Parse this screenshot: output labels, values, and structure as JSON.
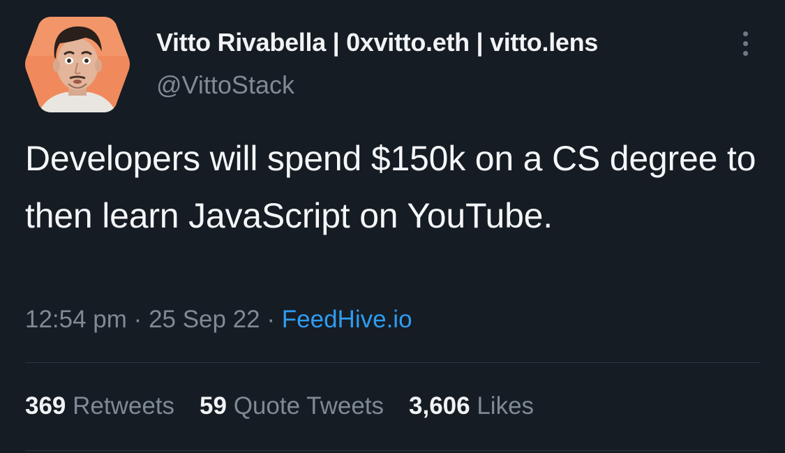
{
  "author": {
    "display_name": "Vitto Rivabella | 0xvitto.eth | vitto.lens",
    "handle": "@VittoStack"
  },
  "tweet": {
    "text": "Developers will spend $150k on a CS degree to then learn JavaScript on YouTube.",
    "time": "12:54 pm",
    "date": "25 Sep 22",
    "separator": "·",
    "source": "FeedHive.io"
  },
  "stats": {
    "retweets_count": "369",
    "retweets_label": "Retweets",
    "quotes_count": "59",
    "quotes_label": "Quote Tweets",
    "likes_count": "3,606",
    "likes_label": "Likes"
  },
  "colors": {
    "background": "#151c24",
    "link": "#2f9cf0",
    "muted": "#7f8a95",
    "avatar_bg": "#f08a5d"
  },
  "icons": {
    "more": "more-vertical-icon"
  }
}
